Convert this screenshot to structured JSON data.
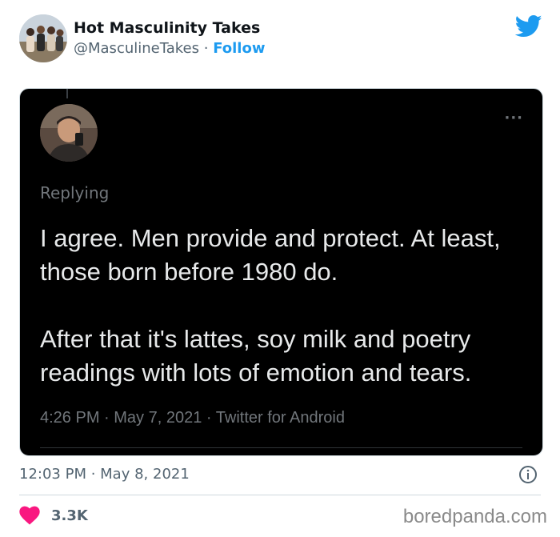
{
  "author": {
    "display_name": "Hot Masculinity Takes",
    "handle": "@MasculineTakes",
    "separator": " · ",
    "follow_label": "Follow"
  },
  "logo": {
    "icon": "twitter-bird-icon",
    "color": "#1d9bf0"
  },
  "embedded_tweet": {
    "replying_label": "Replying",
    "paragraphs": [
      "I agree. Men provide and protect. At least, those born before 1980 do.",
      "After that it's lattes, soy milk and poetry readings with lots of emotion and tears."
    ],
    "time": "4:26 PM",
    "date": "May 7, 2021",
    "source": "Twitter for Android",
    "more_icon": "more-dots-icon"
  },
  "footer": {
    "time": "12:03 PM",
    "date": "May 8, 2021",
    "info_icon": "info-icon",
    "like_count": "3.3K",
    "like_color": "#f91880"
  },
  "watermark": "boredpanda.com"
}
